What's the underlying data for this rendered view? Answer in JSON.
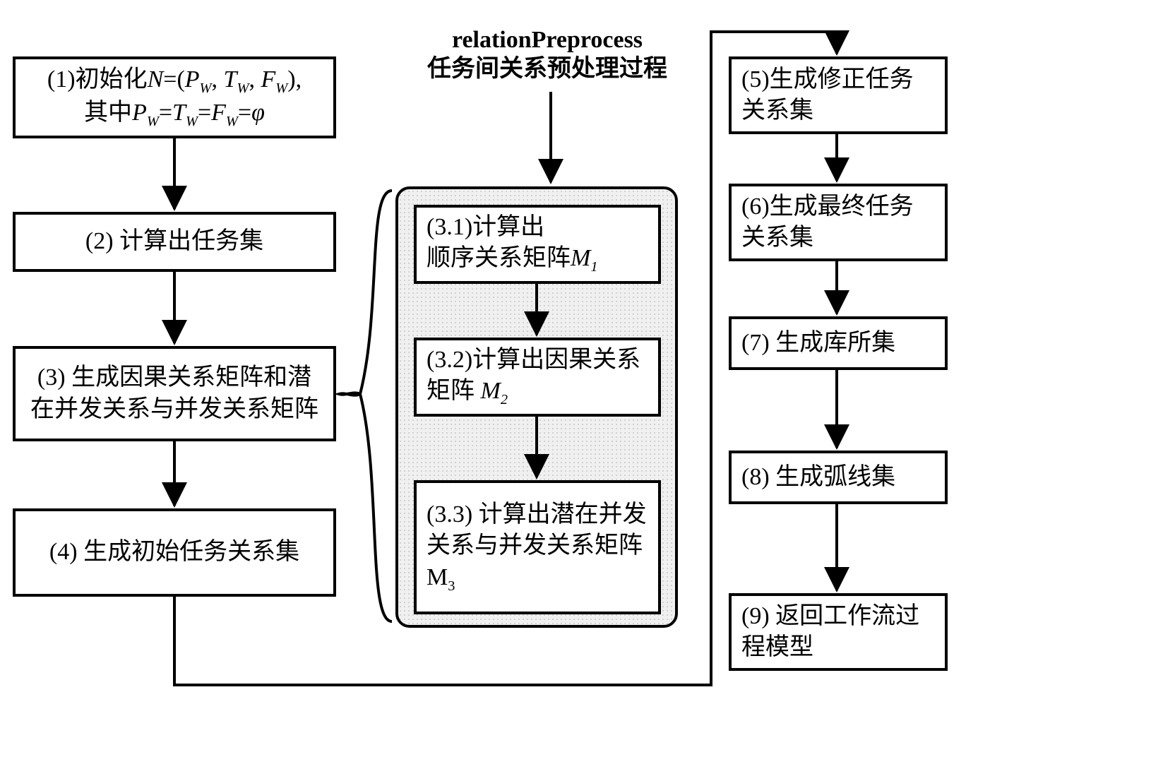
{
  "label": {
    "title_en": "relationPreprocess",
    "title_zh": "任务间关系预处理过程"
  },
  "leftCol": {
    "n1": "(1)初始化<span class='it'>N</span>=(<span class='it'>P</span><span class='sub'>W</span>, <span class='it'>T</span><span class='sub'>W</span>, <span class='it'>F</span><span class='sub'>W</span>),<br>其中<span class='it'>P</span><span class='sub'>W</span>=<span class='it'>T</span><span class='sub'>W</span>=<span class='it'>F</span><span class='sub'>W</span>=<span class='it'>&phi;</span>",
    "n2": "(2) 计算出任务集",
    "n3": "(3) 生成因果关系矩阵和潜在并发关系与并发关系矩阵",
    "n4": "(4) 生成初始任务关系集"
  },
  "midCol": {
    "s31": "(3.1)计算出<br>顺序关系矩阵<span class='it'>M</span><span class='sub'>1</span>",
    "s32": "(3.2)计算出因果关系矩阵 <span class='it'>M</span><span class='sub'>2</span>",
    "s33": "(3.3) 计算出潜在并发关系与并发关系矩阵M<span class='sub' style='font-style:normal;font-family:inherit;'>3</span>"
  },
  "rightCol": {
    "n5": "(5)生成修正任务关系集",
    "n6": "(6)生成最终任务关系集",
    "n7": "(7) 生成库所集",
    "n8": "(8) 生成弧线集",
    "n9": "(9) 返回工作流过程模型"
  }
}
